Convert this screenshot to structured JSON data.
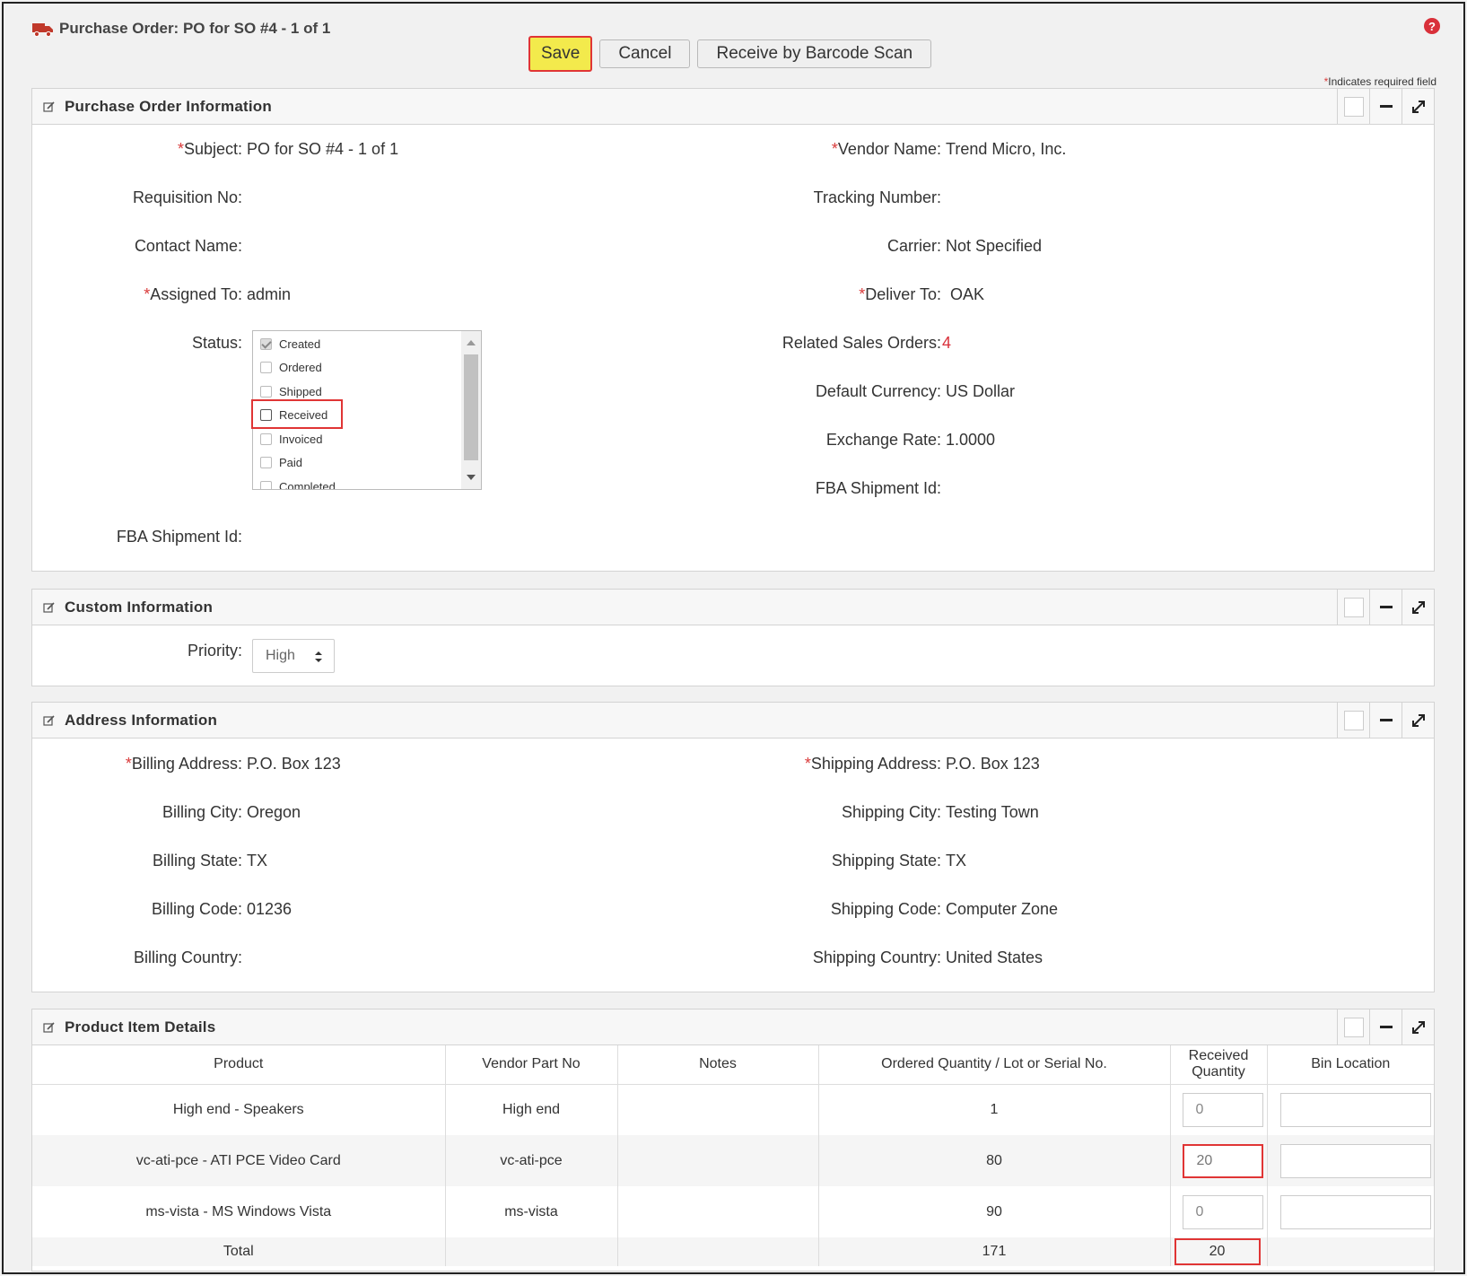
{
  "header": {
    "title": "Purchase Order: PO for SO #4 - 1 of 1",
    "help_label": "?",
    "required_note": "Indicates required field"
  },
  "toolbar": {
    "save_label": "Save",
    "cancel_label": "Cancel",
    "barcode_label": "Receive by Barcode Scan"
  },
  "po_info": {
    "title": "Purchase Order Information",
    "subject_label": "Subject:",
    "subject_value": "PO for SO #4 - 1 of 1",
    "requisition_label": "Requisition No:",
    "contact_label": "Contact Name:",
    "assigned_label": "Assigned To:",
    "assigned_value": "admin",
    "status_label": "Status:",
    "status_options": [
      "Created",
      "Ordered",
      "Shipped",
      "Received",
      "Invoiced",
      "Paid",
      "Completed"
    ],
    "fba_left_label": "FBA Shipment Id:",
    "vendor_label": "Vendor Name:",
    "vendor_value": "Trend Micro, Inc.",
    "tracking_label": "Tracking Number:",
    "carrier_label": "Carrier:",
    "carrier_value": "Not Specified",
    "deliver_label": "Deliver To:",
    "deliver_value": "OAK",
    "related_label": "Related Sales Orders:",
    "related_value": "4",
    "currency_label": "Default Currency:",
    "currency_value": "US Dollar",
    "exchange_label": "Exchange Rate:",
    "exchange_value": "1.0000",
    "fba_right_label": "FBA Shipment Id:"
  },
  "custom_info": {
    "title": "Custom Information",
    "priority_label": "Priority:",
    "priority_value": "High"
  },
  "address_info": {
    "title": "Address Information",
    "billing_address_label": "Billing Address:",
    "billing_address_value": "P.O. Box 123",
    "billing_city_label": "Billing City:",
    "billing_city_value": "Oregon",
    "billing_state_label": "Billing State:",
    "billing_state_value": "TX",
    "billing_code_label": "Billing Code:",
    "billing_code_value": "01236",
    "billing_country_label": "Billing Country:",
    "shipping_address_label": "Shipping Address:",
    "shipping_address_value": "P.O. Box 123",
    "shipping_city_label": "Shipping City:",
    "shipping_city_value": "Testing Town",
    "shipping_state_label": "Shipping State:",
    "shipping_state_value": "TX",
    "shipping_code_label": "Shipping Code:",
    "shipping_code_value": "Computer Zone",
    "shipping_country_label": "Shipping Country:",
    "shipping_country_value": "United States"
  },
  "items": {
    "title": "Product Item Details",
    "columns": [
      "Product",
      "Vendor Part No",
      "Notes",
      "Ordered Quantity / Lot or Serial No.",
      "Received Quantity",
      "Bin Location"
    ],
    "rows": [
      {
        "product": "High end - Speakers",
        "part": "High end",
        "notes": "",
        "ordered": "1",
        "received": "0"
      },
      {
        "product": "vc-ati-pce - ATI PCE Video Card",
        "part": "vc-ati-pce",
        "notes": "",
        "ordered": "80",
        "received": "20"
      },
      {
        "product": "ms-vista - MS Windows Vista",
        "part": "ms-vista",
        "notes": "",
        "ordered": "90",
        "received": "0"
      }
    ],
    "total_label": "Total",
    "total_ordered": "171",
    "total_received": "20"
  },
  "colors": {
    "required_star": "#d9303a",
    "highlight_border": "#e03535",
    "save_bg": "#f3ea4c",
    "truck_icon": "#c0392b"
  }
}
